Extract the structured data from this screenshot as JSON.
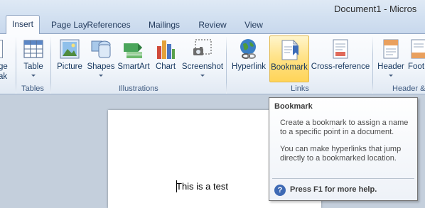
{
  "window": {
    "title": "Document1 - Micros"
  },
  "tabs": [
    {
      "label": "Insert"
    },
    {
      "label": "Page Lay"
    },
    {
      "label": "References"
    },
    {
      "label": "Mailings"
    },
    {
      "label": "Review"
    },
    {
      "label": "View"
    }
  ],
  "ribbon": {
    "partial_left_button": {
      "label_line1": "ge",
      "label_line2": "ak"
    },
    "groups": [
      {
        "label": "Tables",
        "buttons": [
          {
            "label": "Table",
            "icon": "table-icon"
          }
        ]
      },
      {
        "label": "Illustrations",
        "buttons": [
          {
            "label": "Picture",
            "icon": "picture-icon"
          },
          {
            "label": "Shapes",
            "icon": "shapes-icon"
          },
          {
            "label": "SmartArt",
            "icon": "smartart-icon"
          },
          {
            "label": "Chart",
            "icon": "chart-icon"
          },
          {
            "label": "Screenshot",
            "icon": "screenshot-icon"
          }
        ]
      },
      {
        "label": "Links",
        "buttons": [
          {
            "label": "Hyperlink",
            "icon": "hyperlink-icon"
          },
          {
            "label": "Bookmark",
            "icon": "bookmark-icon"
          },
          {
            "label": "Cross-reference",
            "icon": "cross-reference-icon"
          }
        ]
      },
      {
        "label": "Header &",
        "buttons": [
          {
            "label": "Header",
            "icon": "header-icon"
          },
          {
            "label": "Foot",
            "icon": "footer-icon"
          }
        ]
      }
    ]
  },
  "document": {
    "text": "This is a test"
  },
  "tooltip": {
    "title": "Bookmark",
    "paragraph1": "Create a bookmark to assign a name to a specific point in a document.",
    "paragraph2": "You can make hyperlinks that jump directly to a bookmarked location.",
    "help_text": "Press F1 for more help.",
    "help_icon_glyph": "?"
  },
  "colors": {
    "ribbon_hover_fill": "#ffd458",
    "ribbon_hover_border": "#e3b94b",
    "help_icon": "#3d69b4"
  }
}
